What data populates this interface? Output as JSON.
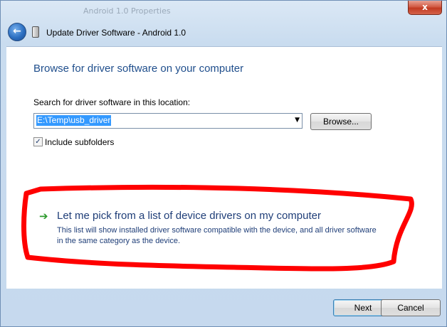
{
  "window": {
    "background_title": "Android 1.0 Properties",
    "title": "Update Driver Software - Android 1.0",
    "close_label": "x"
  },
  "main": {
    "heading": "Browse for driver software on your computer",
    "search_label": "Search for driver software in this location:",
    "location_value": "E:\\Temp\\usb_driver",
    "browse_label": "Browse...",
    "include_subfolders_label": "Include subfolders",
    "include_subfolders_checked": true,
    "pick_title": "Let me pick from a list of device drivers on my computer",
    "pick_description": "This list will show installed driver software compatible with the device, and all driver software in the same category as the device."
  },
  "footer": {
    "next_label": "Next",
    "cancel_label": "Cancel"
  },
  "colors": {
    "annotation_stroke": "#ff0000",
    "link_text": "#1f3e78",
    "heading": "#1f4e8c"
  },
  "icons": {
    "back": "back-arrow-icon",
    "device": "usb-device-icon",
    "pick": "green-arrow-icon"
  }
}
